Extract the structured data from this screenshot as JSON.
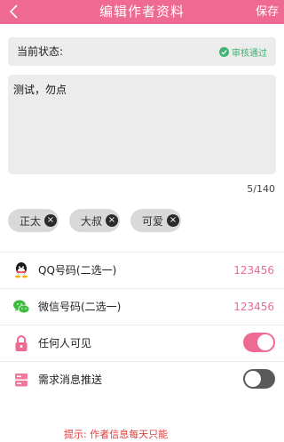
{
  "header": {
    "title": "编辑作者资料",
    "save_label": "保存"
  },
  "status": {
    "label": "当前状态:",
    "value": "审核通过"
  },
  "description": {
    "text": "测试，勿点",
    "counter": "5/140"
  },
  "tags": [
    {
      "label": "正太"
    },
    {
      "label": "大叔"
    },
    {
      "label": "可爱"
    }
  ],
  "qq": {
    "label": "QQ号码(二选一)",
    "value": "123456"
  },
  "wechat": {
    "label": "微信号码(二选一)",
    "value": "123456"
  },
  "visibility": {
    "label": "任何人可见",
    "on": true
  },
  "push": {
    "label": "需求消息推送",
    "on": false
  },
  "hint": "提示: 作者信息每天只能",
  "colors": {
    "accent": "#ef6a93",
    "success": "#3cb371",
    "hint": "#e23b3b"
  }
}
